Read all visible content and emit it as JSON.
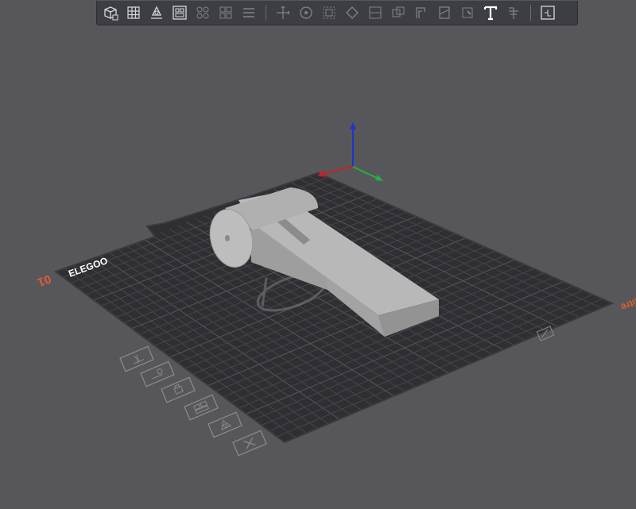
{
  "toolbar": {
    "items": [
      {
        "id": "add-object",
        "icon": "cube-add-icon",
        "enabled": true
      },
      {
        "id": "add-plate",
        "icon": "grid-icon",
        "enabled": true
      },
      {
        "id": "auto-orient",
        "icon": "orient-icon",
        "enabled": true
      },
      {
        "id": "arrange",
        "icon": "arrange-icon",
        "enabled": true
      },
      {
        "id": "split-objects",
        "icon": "split-objects-icon",
        "enabled": false
      },
      {
        "id": "split-parts",
        "icon": "split-parts-icon",
        "enabled": false
      },
      {
        "id": "layers",
        "icon": "layers-icon",
        "enabled": false
      },
      {
        "id": "move",
        "icon": "move-icon",
        "enabled": false
      },
      {
        "id": "rotate",
        "icon": "rotate-icon",
        "enabled": false
      },
      {
        "id": "scale",
        "icon": "scale-icon",
        "enabled": false
      },
      {
        "id": "lay-on-face",
        "icon": "lay-on-face-icon",
        "enabled": false
      },
      {
        "id": "cut",
        "icon": "cut-icon",
        "enabled": false
      },
      {
        "id": "mesh-boolean",
        "icon": "boolean-icon",
        "enabled": false
      },
      {
        "id": "support-paint",
        "icon": "support-paint-icon",
        "enabled": false
      },
      {
        "id": "seam-paint",
        "icon": "seam-paint-icon",
        "enabled": false
      },
      {
        "id": "color-paint",
        "icon": "color-paint-icon",
        "enabled": false
      },
      {
        "id": "text",
        "icon": "text-icon",
        "enabled": true
      },
      {
        "id": "measure",
        "icon": "measure-icon",
        "enabled": false
      },
      {
        "id": "assembly",
        "icon": "puzzle-icon",
        "enabled": true
      }
    ]
  },
  "plate": {
    "brand": "ELEGOO",
    "number": "01",
    "name": "Sans titre",
    "label_color": "#e35f2e"
  },
  "plate_tools": [
    {
      "id": "pick",
      "icon": "pick-icon"
    },
    {
      "id": "auto-orient-plate",
      "icon": "orient-plate-icon"
    },
    {
      "id": "lock",
      "icon": "lock-icon"
    },
    {
      "id": "arrange-plate",
      "icon": "arrange-plate-icon"
    },
    {
      "id": "plate-settings",
      "icon": "plate-settings-icon"
    },
    {
      "id": "delete-plate",
      "icon": "close-icon"
    }
  ],
  "colors": {
    "background": "#57575b",
    "bed": "#2f2f33",
    "grid": "#4a4a50",
    "model": "#b3b3b3",
    "axis_x": "#c42222",
    "axis_y": "#22b042",
    "axis_z": "#2233c8"
  }
}
